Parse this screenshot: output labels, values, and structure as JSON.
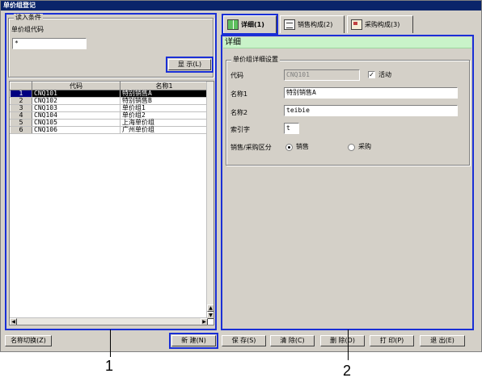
{
  "window": {
    "title": "单价组登记"
  },
  "left": {
    "group_title": "读入条件",
    "code_label": "单价组代码",
    "code_value": "*",
    "display_button": "显  示(L)",
    "grid": {
      "columns": [
        "代码",
        "名称1"
      ],
      "rows": [
        {
          "num": "1",
          "code": "CNQ101",
          "name": "特别销售A",
          "selected": true
        },
        {
          "num": "2",
          "code": "CNQ102",
          "name": "特别销售B"
        },
        {
          "num": "3",
          "code": "CNQ103",
          "name": "单价组1"
        },
        {
          "num": "4",
          "code": "CNQ104",
          "name": "单价组2"
        },
        {
          "num": "5",
          "code": "CNQ105",
          "name": "上海单价组"
        },
        {
          "num": "6",
          "code": "CNQ106",
          "name": "广州单价组"
        }
      ]
    }
  },
  "tabs": [
    {
      "label": "详细(1)",
      "icon": "book-icon",
      "active": true
    },
    {
      "label": "销售构成(2)",
      "icon": "document-icon"
    },
    {
      "label": "采购构成(3)",
      "icon": "cart-icon"
    }
  ],
  "detail": {
    "header": "详细",
    "group_title": "单价组详细设置",
    "code_label": "代码",
    "code_value": "CNQ101",
    "active_label": "活动",
    "active_checked": true,
    "name1_label": "名称1",
    "name1_value": "特别销售A",
    "name2_label": "名称2",
    "name2_value": "teibie",
    "index_label": "索引字",
    "index_value": "t",
    "division_label": "销售/采购区分",
    "sales_label": "销售",
    "purchase_label": "采购",
    "selected_division": "sales"
  },
  "bottom_buttons": {
    "name_switch": "名称切换(Z)",
    "new": "新  建(N)",
    "save": "保  存(S)",
    "clear": "清  除(C)",
    "delete": "删  除(D)",
    "print": "打  印(P)",
    "exit": "退  出(E)"
  },
  "annotations": {
    "one": "1",
    "two": "2"
  },
  "colors": {
    "highlight": "#1a2fd6",
    "title_bar": "#0a246a",
    "detail_header": "#c9f3c9"
  }
}
